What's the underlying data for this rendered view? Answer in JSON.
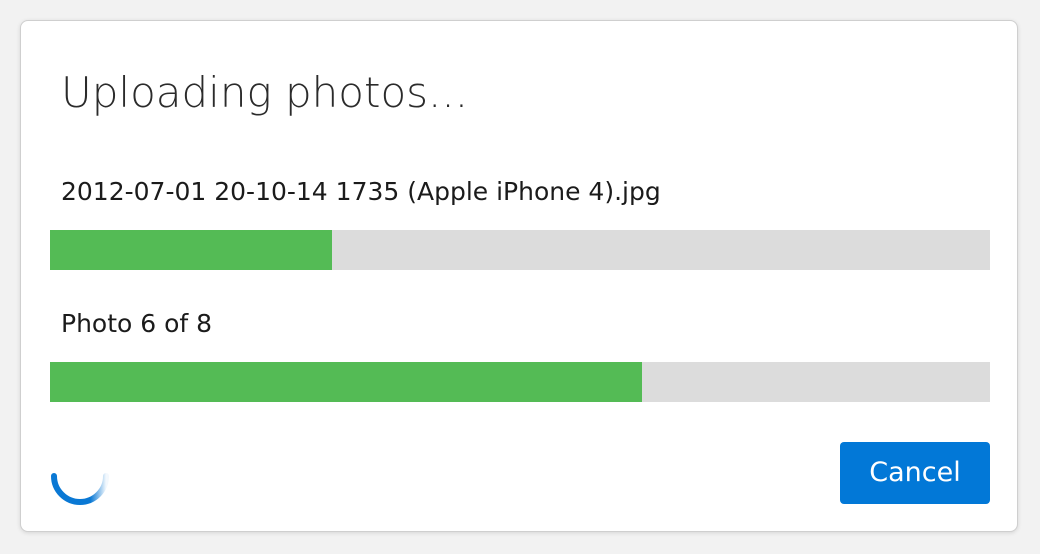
{
  "dialog": {
    "title": "Uploading photos...",
    "current_file": {
      "name": "2012-07-01 20-10-14 1735 (Apple iPhone 4).jpg",
      "progress_percent": 30
    },
    "overall": {
      "status_text": "Photo 6 of 8",
      "progress_percent": 63
    },
    "spinner_icon": "loading-spinner-icon",
    "cancel_label": "Cancel"
  },
  "colors": {
    "progress_fill": "#54bb55",
    "progress_track": "#dcdcdc",
    "accent": "#0278d7",
    "spinner": "#0a78d4"
  }
}
